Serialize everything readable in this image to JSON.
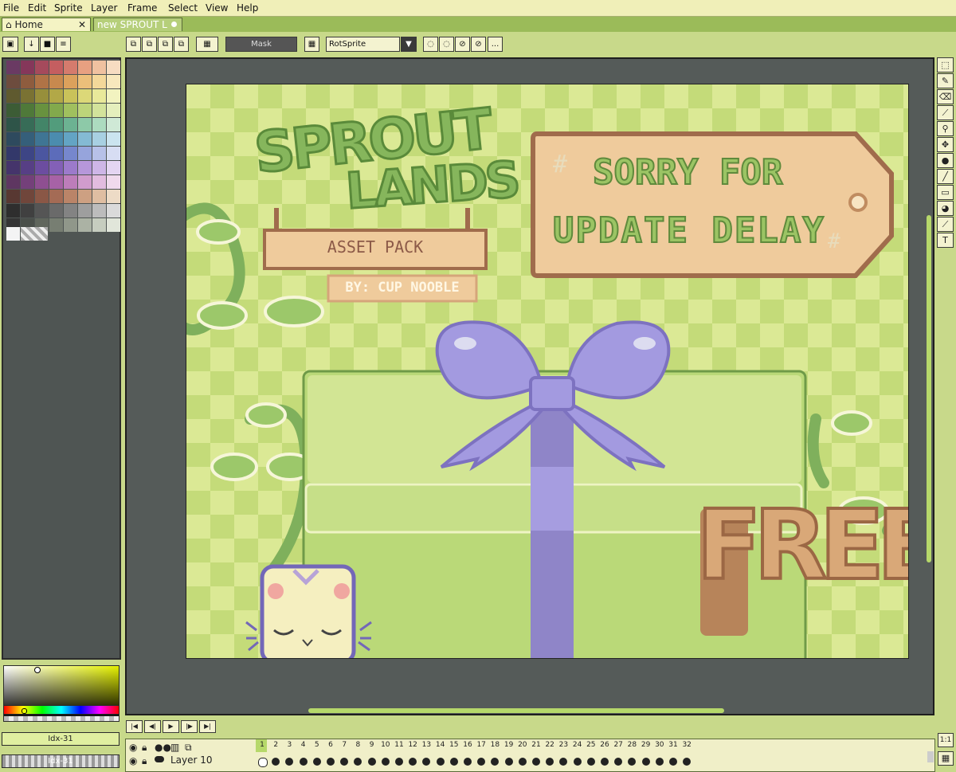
{
  "menu": [
    "File",
    "Edit",
    "Sprite",
    "Layer",
    "Frame",
    "Select",
    "View",
    "Help"
  ],
  "tabs": {
    "home": "Home",
    "home_close": "✕",
    "sprite": "new SPROUT L"
  },
  "toolbar": {
    "mask_label": "Mask",
    "rotation_algorithm": "RotSprite",
    "more": "..."
  },
  "palette": {
    "colors": [
      "#6a3a63",
      "#85375a",
      "#a54a5c",
      "#c45e60",
      "#d57b6d",
      "#e8a081",
      "#f0c1a0",
      "#f7dcc2",
      "#6d4c3e",
      "#8e5c3e",
      "#b07346",
      "#c8894e",
      "#dca15c",
      "#ecbf7a",
      "#f4d89a",
      "#f8e8bd",
      "#5f5a2f",
      "#7a7233",
      "#978f3b",
      "#b2a847",
      "#c9c25a",
      "#dcd878",
      "#e9e99a",
      "#f2f3c0",
      "#3c5c35",
      "#4f7939",
      "#68923f",
      "#82a94c",
      "#a0c05e",
      "#bdd47a",
      "#d3e39b",
      "#e5efbd",
      "#2e5448",
      "#376c57",
      "#438568",
      "#529c7c",
      "#6cb292",
      "#8dc9a8",
      "#acdbbf",
      "#cfe9d6",
      "#2e4a5e",
      "#355f7a",
      "#3f7594",
      "#4b8cae",
      "#63a4c4",
      "#84bad4",
      "#a8d0e2",
      "#cbe4ef",
      "#33386a",
      "#3d4585",
      "#4b56a0",
      "#5c6cba",
      "#7687cd",
      "#96a4dc",
      "#b7c1e8",
      "#d7ddf3",
      "#45346b",
      "#573f85",
      "#6c4da0",
      "#8360b7",
      "#9c7acb",
      "#b697da",
      "#ceb6e7",
      "#e4d5f2",
      "#5e3661",
      "#74407a",
      "#8e4f91",
      "#a762a6",
      "#bd7dba",
      "#d19ccd",
      "#e2bcdf",
      "#f0daed",
      "#583832",
      "#70463b",
      "#8a5746",
      "#a46b55",
      "#ba8468",
      "#cda082",
      "#dfbea2",
      "#eddbc6",
      "#2e2e2e",
      "#404040",
      "#555555",
      "#6a6a6a",
      "#838383",
      "#9e9e9e",
      "#bcbcbc",
      "#dadada",
      "#353535",
      "#4a4f4a",
      "#60665d",
      "#777e72",
      "#90978a",
      "#abb2a4",
      "#c6cdbf",
      "#e1e6da"
    ],
    "idx_fg": "Idx-31",
    "idx_bg": "Idx-31"
  },
  "artwork": {
    "title_line1": "SPROUT",
    "title_line2": "LANDS",
    "asset_pack": "ASSET PACK",
    "by": "BY: CUP NOOBLE",
    "tag_line1": "SORRY FOR",
    "tag_line2": "UPDATE DELAY",
    "free": "FREE"
  },
  "timeline": {
    "frames": [
      "1",
      "2",
      "3",
      "4",
      "5",
      "6",
      "7",
      "8",
      "9",
      "10",
      "11",
      "12",
      "13",
      "14",
      "15",
      "16",
      "17",
      "18",
      "19",
      "20",
      "21",
      "22",
      "23",
      "24",
      "25",
      "26",
      "27",
      "28",
      "29",
      "30",
      "31",
      "32"
    ],
    "current_frame": "1",
    "layer_name": "Layer 10"
  },
  "zoom_label": "1:1"
}
